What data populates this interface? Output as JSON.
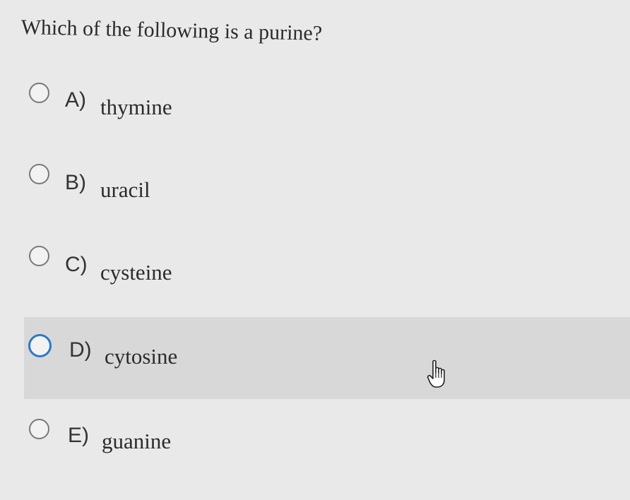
{
  "question": "Which of the following is a purine?",
  "options": [
    {
      "letter": "A)",
      "text": "thymine"
    },
    {
      "letter": "B)",
      "text": "uracil"
    },
    {
      "letter": "C)",
      "text": "cysteine"
    },
    {
      "letter": "D)",
      "text": "cytosine"
    },
    {
      "letter": "E)",
      "text": "guanine"
    }
  ],
  "hovered_option": "D)",
  "colors": {
    "background": "#e9e9e9",
    "hover_background": "#d8d8d8",
    "radio_border": "#7a7a7a",
    "radio_hover_border": "#2d78c8"
  },
  "cursor_icon": "hand-pointer-icon"
}
